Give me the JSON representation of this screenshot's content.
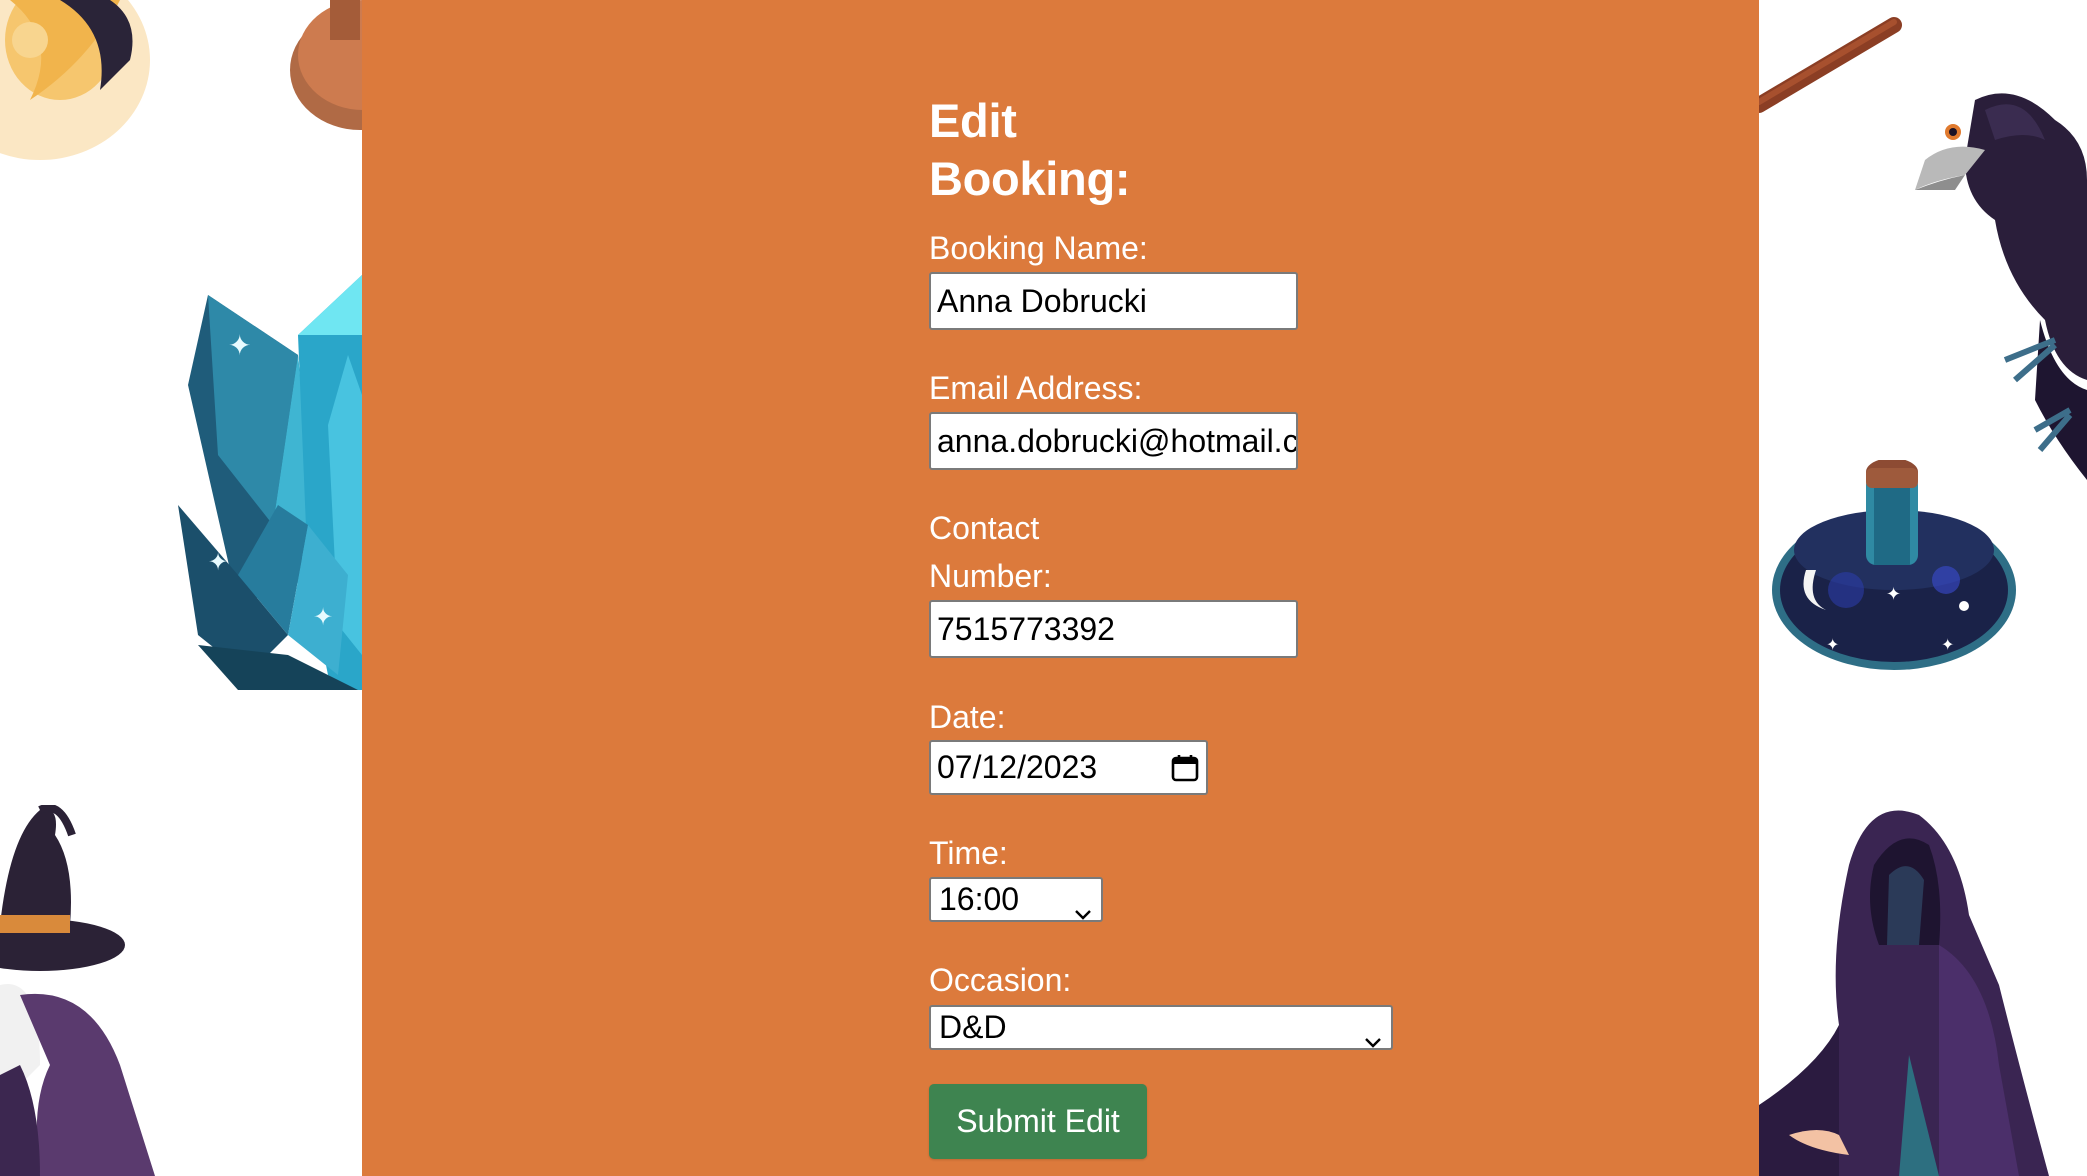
{
  "theme": {
    "panel_bg": "#DC7A3C",
    "button_bg": "#3E8450"
  },
  "form": {
    "title": "Edit Booking:",
    "booking_name_label": "Booking Name:",
    "booking_name_value": "Anna Dobrucki",
    "email_label": "Email Address:",
    "email_value": "anna.dobrucki@hotmail.c",
    "contact_label": "Contact Number:",
    "contact_value": "7515773392",
    "date_label": "Date:",
    "date_value": "07/12/2023",
    "time_label": "Time:",
    "time_value": "16:00",
    "occasion_label": "Occasion:",
    "occasion_value": "D&D",
    "submit_label": "Submit Edit"
  },
  "icons": {
    "calendar": "calendar-icon",
    "select_chevron": "chevron-down-icon"
  },
  "decorations": [
    "moon-illustration",
    "cauldron-illustration",
    "crystal-illustration",
    "witch-illustration",
    "broom-illustration",
    "raven-illustration",
    "potion-bottle-illustration",
    "hooded-figure-illustration"
  ]
}
